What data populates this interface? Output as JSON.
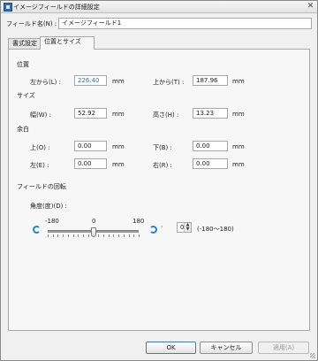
{
  "window": {
    "title": "イメージフィールドの詳細設定",
    "close_glyph": "✕"
  },
  "field_name": {
    "label": "フィールド名(N) :",
    "value": "イメージフィールド1"
  },
  "tabs": [
    {
      "label": "書式設定",
      "active": false
    },
    {
      "label": "位置とサイズ",
      "active": true
    }
  ],
  "position": {
    "heading": "位置",
    "left_label": "左から(L) :",
    "left_value": "226.40",
    "left_unit": "mm",
    "top_label": "上から(T) :",
    "top_value": "187.96",
    "top_unit": "mm"
  },
  "size": {
    "heading": "サイズ",
    "width_label": "幅(W) :",
    "width_value": "52.92",
    "width_unit": "mm",
    "height_label": "高さ(H) :",
    "height_value": "13.23",
    "height_unit": "mm"
  },
  "margin": {
    "heading": "余白",
    "top_label": "上(O) :",
    "top_value": "0.00",
    "top_unit": "mm",
    "bottom_label": "下(B) :",
    "bottom_value": "0.00",
    "bottom_unit": "mm",
    "left_label": "左(E) :",
    "left_value": "0.00",
    "left_unit": "mm",
    "right_label": "右(R) :",
    "right_value": "0.00",
    "right_unit": "mm"
  },
  "rotation": {
    "heading": "フィールドの回転",
    "angle_label": "角度(度)(D) :",
    "scale_min": "-180",
    "scale_mid": "0",
    "scale_max": "180",
    "slider_value": 0,
    "spin_value": "0",
    "range_hint": "(-180〜180)",
    "icon_ccw": "rotate-ccw-icon",
    "icon_cw": "rotate-cw-icon"
  },
  "buttons": {
    "ok": "OK",
    "cancel": "キャンセル",
    "apply": "適用(A)"
  },
  "colors": {
    "accent": "#2a83c6",
    "selected_text": "#3b6fb5"
  }
}
